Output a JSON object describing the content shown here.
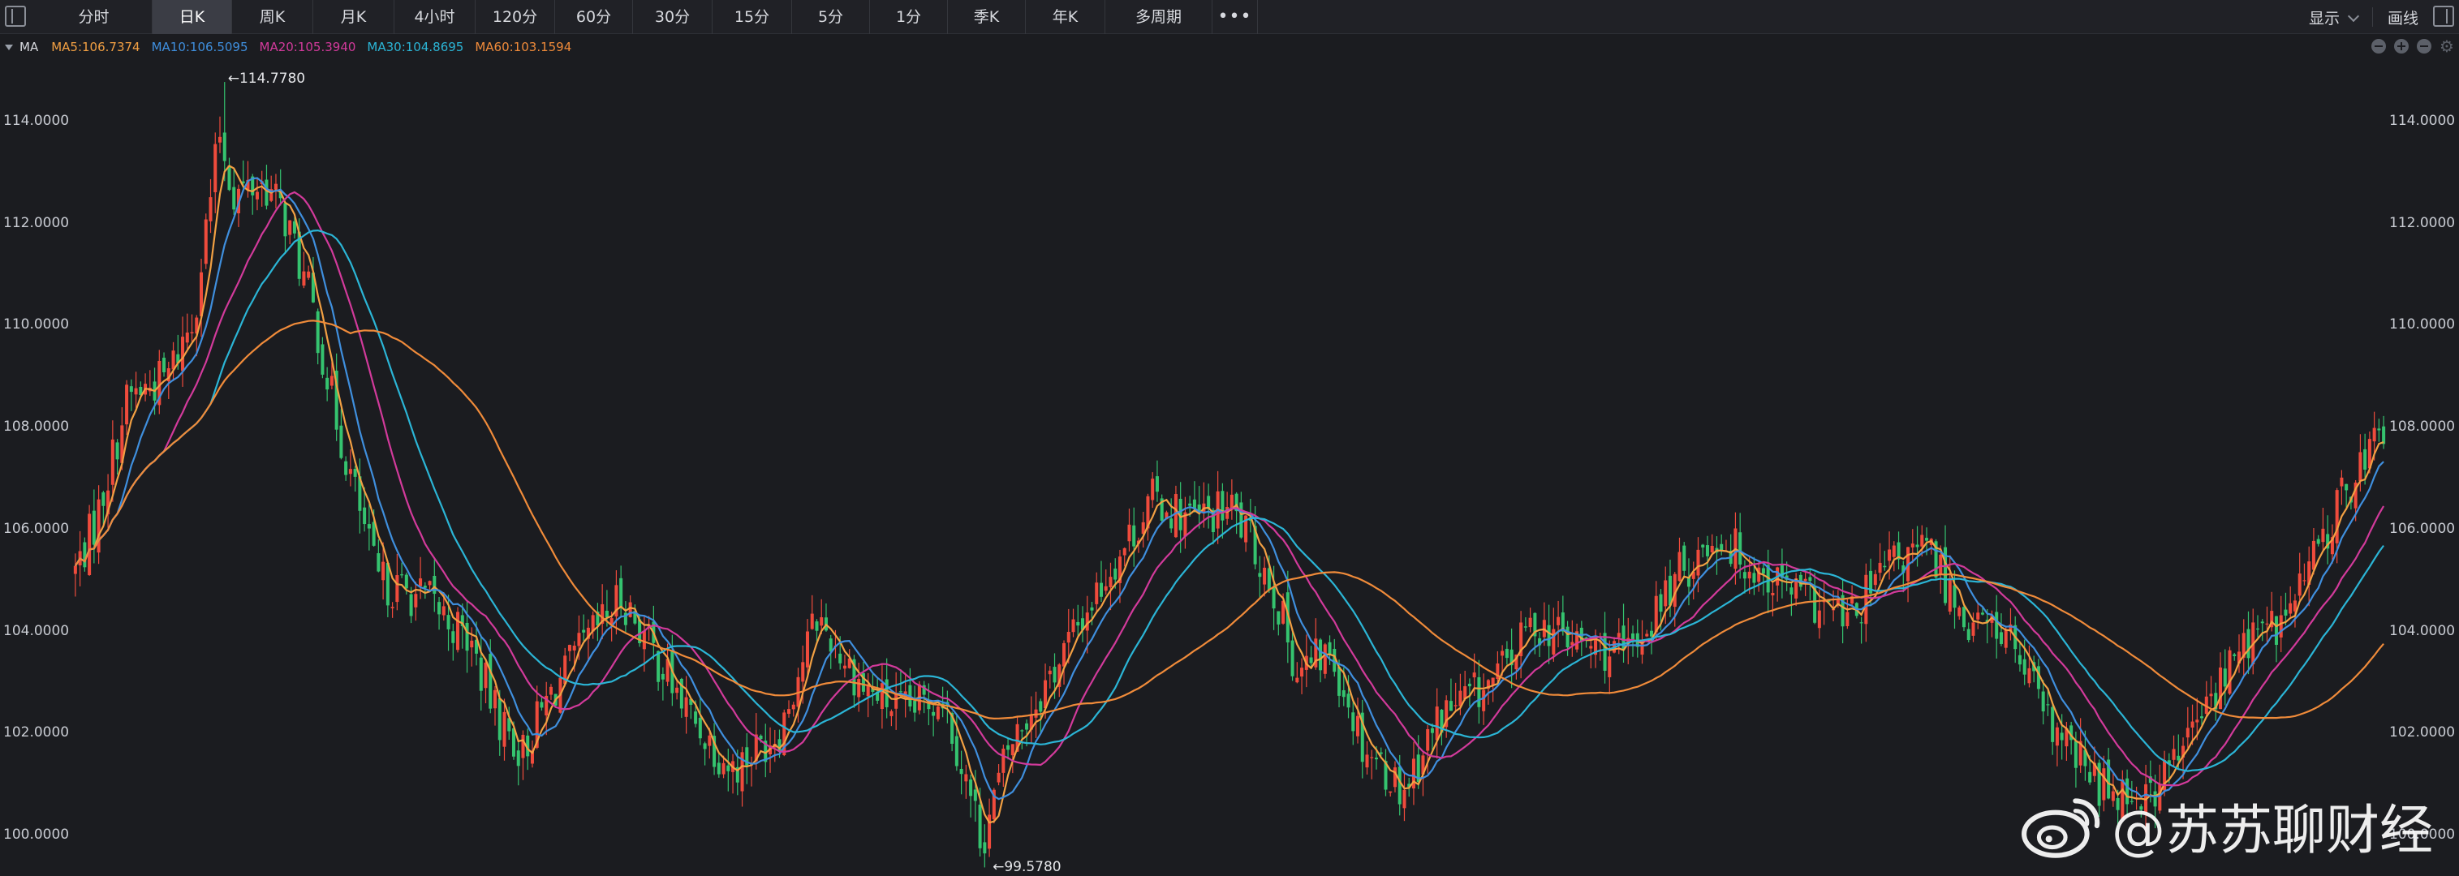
{
  "toolbar": {
    "tabs": [
      "分时",
      "日K",
      "周K",
      "月K",
      "4小时",
      "120分",
      "60分",
      "30分",
      "15分",
      "5分",
      "1分",
      "季K",
      "年K",
      "多周期",
      "•••"
    ],
    "active_tab": "日K",
    "display_label": "显示",
    "draw_label": "画线"
  },
  "legend": {
    "name": "MA",
    "ma5": "MA5:106.7374",
    "ma10": "MA10:106.5095",
    "ma20": "MA20:105.3940",
    "ma30": "MA30:104.8695",
    "ma60": "MA60:103.1594"
  },
  "colors": {
    "up": "#ef4b3c",
    "down": "#35c36f",
    "ma5": "#f2a043",
    "ma10": "#3f8fde",
    "ma20": "#d23a9b",
    "ma30": "#2bb5d6",
    "ma60": "#f08b3a",
    "background": "#1b1c20"
  },
  "markers": {
    "high": "←114.7780",
    "low": "←99.5780"
  },
  "watermark": {
    "text": "@苏苏聊财经",
    "icon": "weibo-icon"
  },
  "chart_data": {
    "type": "candlestick",
    "ylim": [
      99.7,
      115.5
    ],
    "yticks": [
      "100.0000",
      "102.0000",
      "104.0000",
      "106.0000",
      "108.0000",
      "110.0000",
      "112.0000",
      "114.0000"
    ],
    "ytick_values": [
      100,
      102,
      104,
      106,
      108,
      110,
      112,
      114
    ],
    "high_marker": 114.778,
    "low_marker": 99.578,
    "candle_count": 496,
    "anchors": [
      [
        0,
        105.2
      ],
      [
        8,
        106.2
      ],
      [
        20,
        108.6
      ],
      [
        35,
        109.0
      ],
      [
        45,
        110.2
      ],
      [
        55,
        113.8
      ],
      [
        60,
        112.6
      ],
      [
        72,
        112.8
      ],
      [
        80,
        112.1
      ],
      [
        90,
        110.4
      ],
      [
        100,
        108.0
      ],
      [
        115,
        105.0
      ],
      [
        135,
        104.6
      ],
      [
        150,
        103.8
      ],
      [
        160,
        102.4
      ],
      [
        170,
        101.6
      ],
      [
        180,
        102.7
      ],
      [
        195,
        103.8
      ],
      [
        208,
        104.7
      ],
      [
        220,
        103.6
      ],
      [
        232,
        102.5
      ],
      [
        250,
        101.3
      ],
      [
        268,
        102.1
      ],
      [
        282,
        104.3
      ],
      [
        300,
        102.9
      ],
      [
        315,
        102.4
      ],
      [
        330,
        102.8
      ],
      [
        345,
        99.9
      ],
      [
        355,
        101.7
      ],
      [
        375,
        103.5
      ],
      [
        392,
        105.1
      ],
      [
        410,
        106.6
      ],
      [
        425,
        106.2
      ],
      [
        440,
        106.4
      ],
      [
        455,
        105.0
      ],
      [
        465,
        103.2
      ],
      [
        478,
        103.6
      ],
      [
        490,
        101.8
      ],
      [
        505,
        100.9
      ],
      [
        520,
        102.4
      ],
      [
        540,
        103.0
      ],
      [
        555,
        104.2
      ],
      [
        570,
        103.8
      ],
      [
        590,
        103.5
      ],
      [
        610,
        105.1
      ],
      [
        625,
        105.9
      ],
      [
        640,
        105.2
      ],
      [
        660,
        104.6
      ],
      [
        675,
        104.2
      ],
      [
        690,
        105.3
      ],
      [
        705,
        105.6
      ],
      [
        720,
        104.2
      ],
      [
        735,
        104.0
      ],
      [
        750,
        102.2
      ],
      [
        770,
        101.0
      ],
      [
        790,
        100.8
      ],
      [
        805,
        102.0
      ],
      [
        825,
        103.8
      ],
      [
        840,
        104.2
      ],
      [
        855,
        105.8
      ],
      [
        870,
        107.4
      ],
      [
        880,
        108.0
      ]
    ]
  }
}
